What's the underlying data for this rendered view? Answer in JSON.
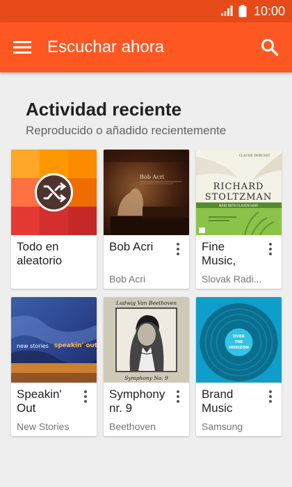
{
  "status": {
    "time": "10:00"
  },
  "appbar": {
    "title": "Escuchar ahora"
  },
  "section": {
    "title": "Actividad reciente",
    "subtitle": "Reproducido o añadido recientemente"
  },
  "cards": [
    {
      "title": "Todo en aleatorio",
      "subtitle": ""
    },
    {
      "title": "Bob Acri",
      "subtitle": "Bob Acri",
      "art_text": "Bob Acri"
    },
    {
      "title": "Fine Music,",
      "subtitle": "Slovak Radi...",
      "art_text": [
        "CLAUDE DEBUSSY",
        "RICHARD",
        "STOLTZMAN",
        "MAID WITH FLAXEN HAIR"
      ]
    },
    {
      "title": "Speakin' Out",
      "subtitle": "New Stories",
      "art_text": [
        "new stories",
        "speakin' out"
      ]
    },
    {
      "title": "Symphony nr. 9",
      "subtitle": "Beethoven",
      "art_text": [
        "Ludwig Van Beethoven",
        "Symphony No. 9"
      ]
    },
    {
      "title": "Brand Music",
      "subtitle": "Samsung",
      "art_text": [
        "OVER",
        "THE",
        "HORIZON"
      ]
    }
  ],
  "colors": {
    "status_bar": "#e64a19",
    "app_bar": "#ff5722",
    "background": "#eeeeee"
  }
}
